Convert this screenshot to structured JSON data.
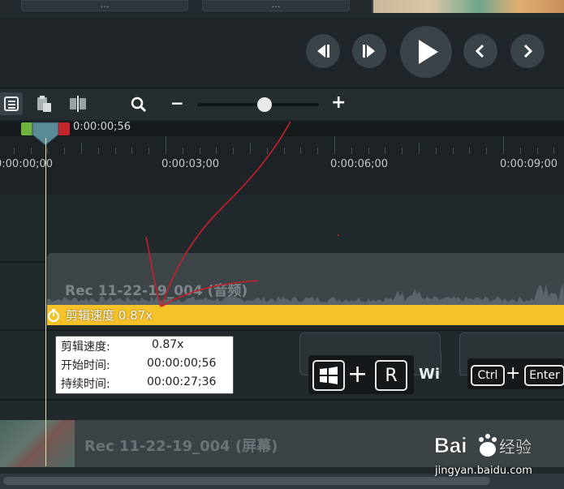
{
  "top_strip": {
    "btn_left_label": "…",
    "btn_right_label": "…"
  },
  "player": {
    "controls": [
      "step-back-icon",
      "step-forward-icon",
      "play-icon",
      "prev-icon",
      "next-icon"
    ]
  },
  "toolbar": {
    "icons": [
      "list-icon",
      "clipboard-icon",
      "split-icon",
      "magnifier-icon"
    ],
    "zoom_minus": "−",
    "zoom_plus": "+",
    "zoom_level": 0.55
  },
  "timeline": {
    "current_time": "0:00:00;56",
    "ruler_labels": [
      "0:00:00;00",
      "0:00:03;00",
      "0:00:06;00",
      "0:00:09;00"
    ]
  },
  "tracks": {
    "audio_clip_title": "Rec 11-22-19_004 (音频)",
    "speed_badge": "剪辑速度 0.87x",
    "tooltip": {
      "rows": [
        {
          "label": "剪辑速度:",
          "value": "0.87x"
        },
        {
          "label": "开始时间:",
          "value": "00:00:00;56"
        },
        {
          "label": "持续时间:",
          "value": "00:00:27;36"
        }
      ]
    },
    "callout1": {
      "key_plus": "+",
      "key_r": "R",
      "trailing": "Wi"
    },
    "callout2": {
      "key_ctrl": "Ctrl",
      "key_plus": "+",
      "key_enter": "Enter"
    },
    "video_clip_title": "Rec 11-22-19_004 (屏幕)"
  },
  "watermark": {
    "brand": "Baidu经验",
    "url": "jingyan.baidu.com"
  },
  "colors": {
    "speed_bar": "#f6c22a",
    "annotation": "#c8202a",
    "background": "#1b2125"
  }
}
